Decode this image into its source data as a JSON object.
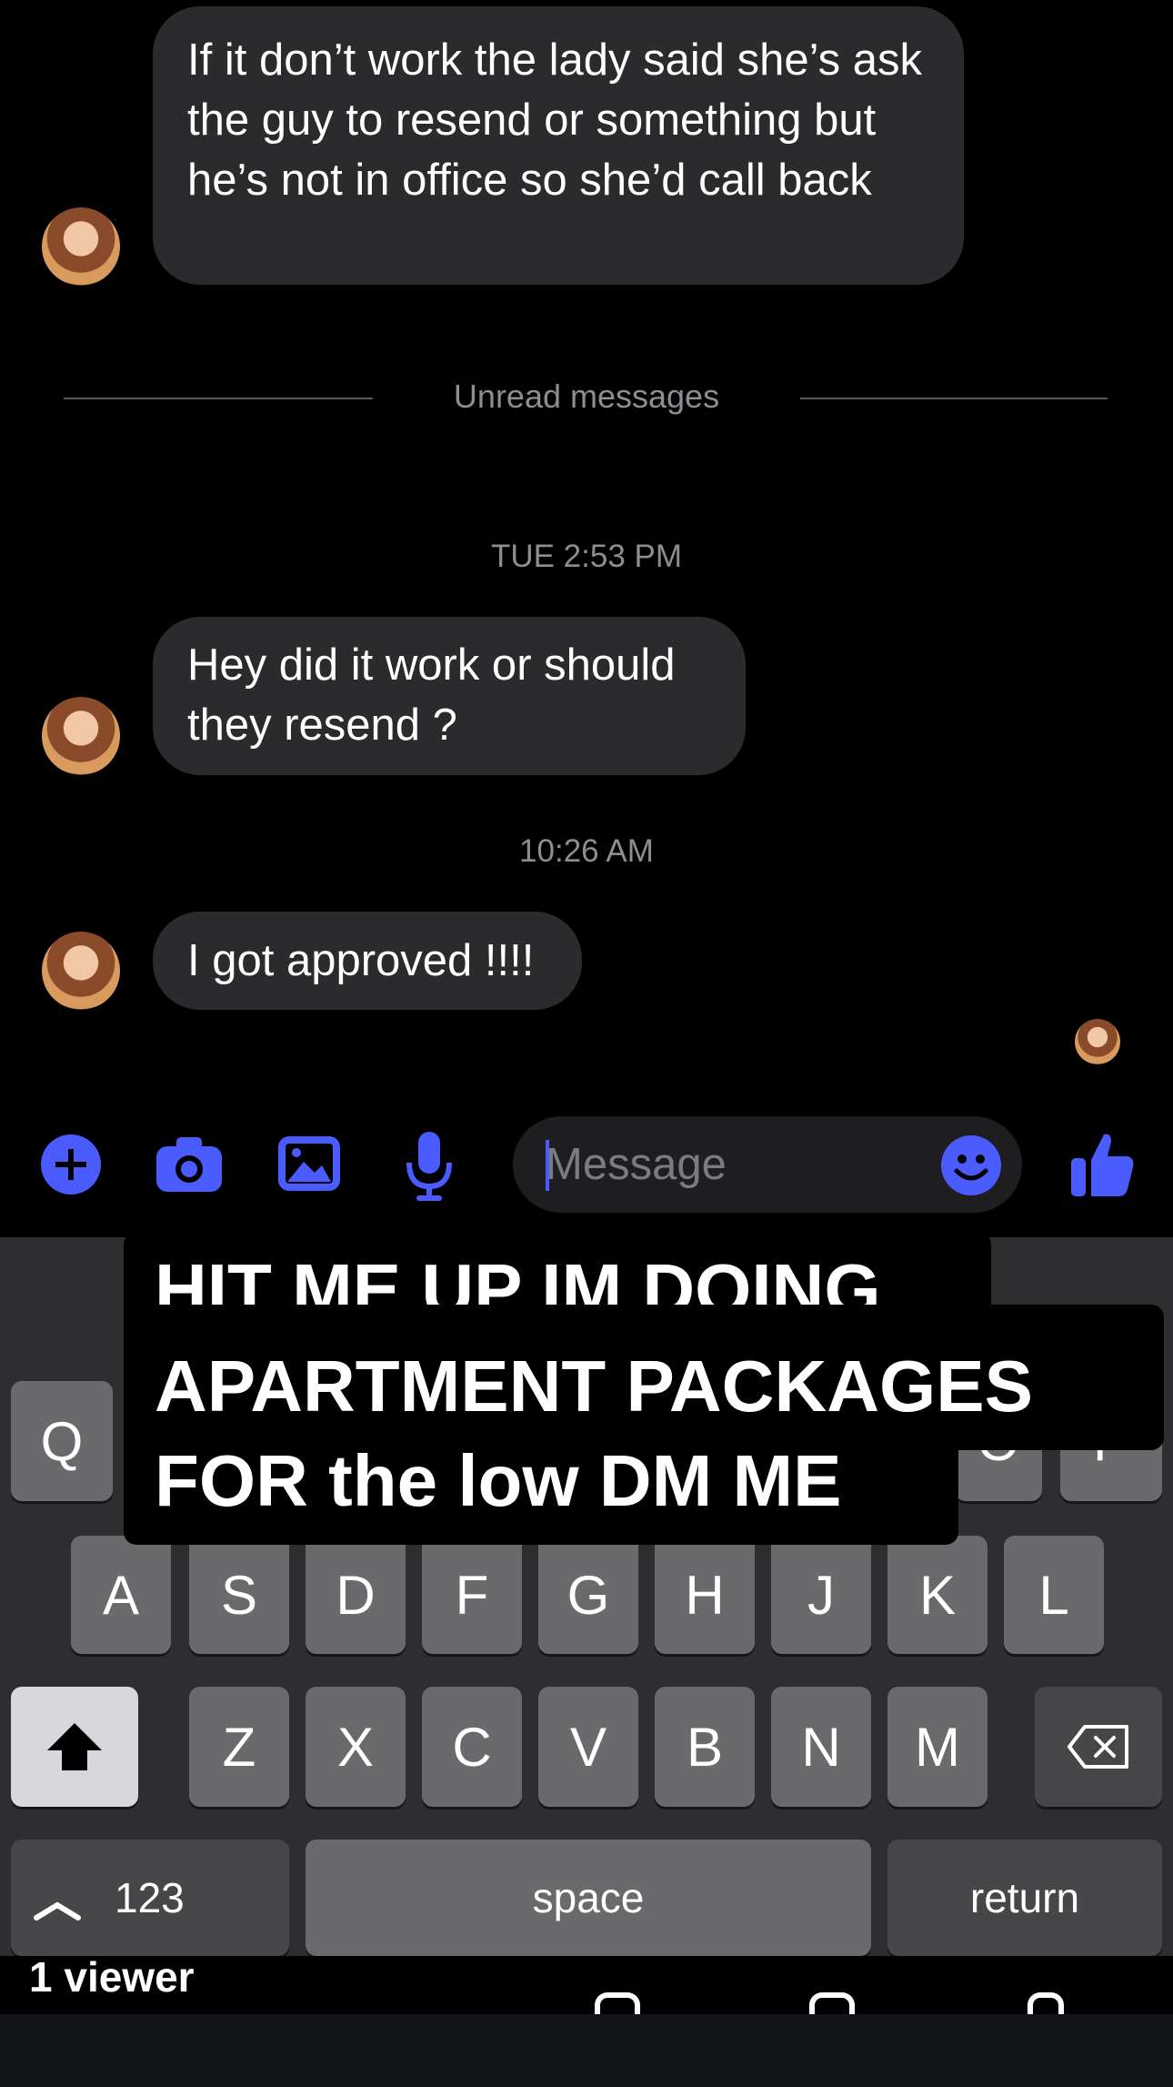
{
  "chat": {
    "message_1": "If it don’t work the lady said she’s ask the guy to resend or something but he’s not in office so she’d call back",
    "unread_label": "Unread messages",
    "timestamp_1": "TUE 2:53 PM",
    "message_2": "Hey did it work or should they resend ?",
    "timestamp_2": "10:26 AM",
    "message_3": "I got approved !!!!"
  },
  "composer": {
    "placeholder": "Message",
    "icons": [
      "plus-icon",
      "camera-icon",
      "image-icon",
      "microphone-icon",
      "emoji-icon",
      "thumbs-up-icon"
    ],
    "accent_color": "#4b5cff"
  },
  "keyboard": {
    "row1": [
      "Q",
      "O",
      "P"
    ],
    "row2": [
      "A",
      "S",
      "D",
      "F",
      "G",
      "H",
      "J",
      "K",
      "L"
    ],
    "row3": [
      "Z",
      "X",
      "C",
      "V",
      "B",
      "N",
      "M"
    ],
    "numbers_label": "123",
    "space_label": "space",
    "return_label": "return"
  },
  "overlay": {
    "caption_line_1": "HIT ME UP IM DOING",
    "caption_line_2": "APARTMENT PACKAGES",
    "caption_line_3": "FOR the low DM ME"
  },
  "footer": {
    "viewer_label": "1 viewer"
  }
}
